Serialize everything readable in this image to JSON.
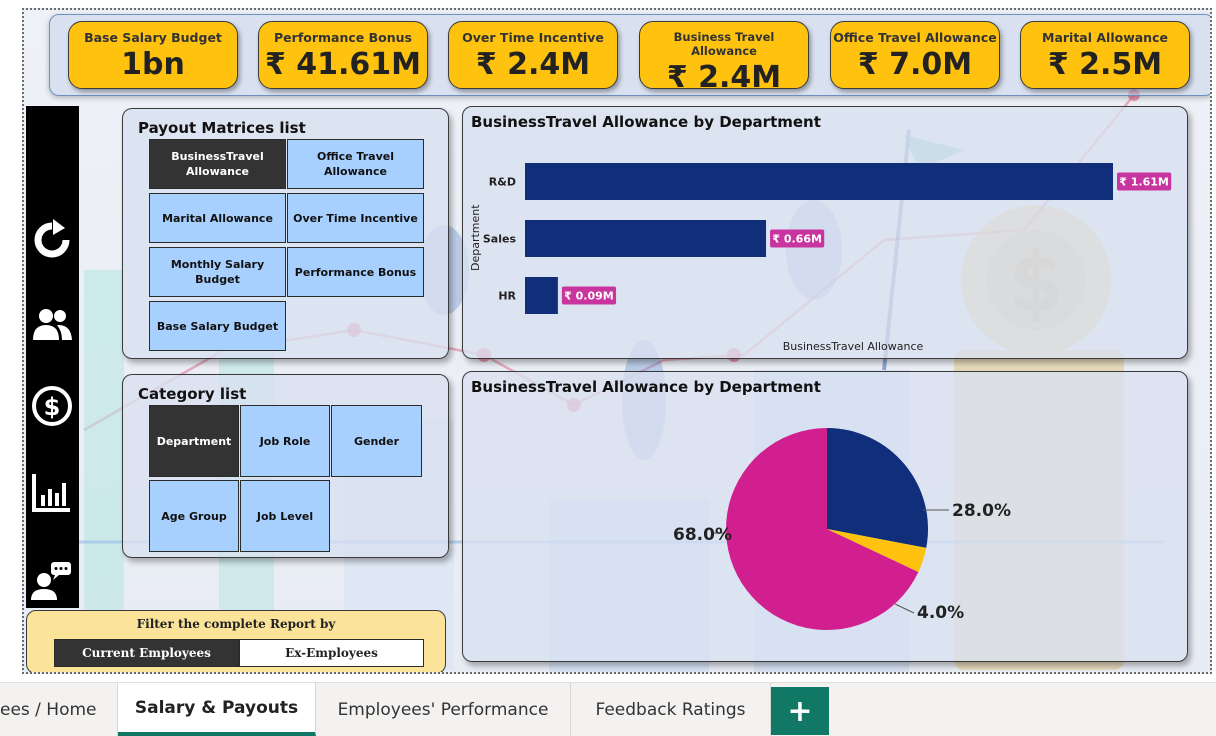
{
  "kpis": [
    {
      "title": "Base Salary Budget",
      "value": "1bn"
    },
    {
      "title": "Performance Bonus",
      "value": "₹ 41.61M"
    },
    {
      "title": "Over Time Incentive",
      "value": "₹ 2.4M"
    },
    {
      "title": "Business Travel Allowance",
      "value": "₹ 2.4M"
    },
    {
      "title": "Office Travel Allowance",
      "value": "₹ 7.0M"
    },
    {
      "title": "Marital Allowance",
      "value": "₹ 2.5M"
    }
  ],
  "nav_rail": {
    "icons": [
      "refresh-icon",
      "users-icon",
      "dollar-icon",
      "bar-chart-icon",
      "feedback-icon"
    ]
  },
  "payout_matrices": {
    "title": "Payout Matrices list",
    "items": [
      {
        "label": "BusinessTravel Allowance",
        "selected": true
      },
      {
        "label": "Office Travel Allowance",
        "selected": false
      },
      {
        "label": "Marital Allowance",
        "selected": false
      },
      {
        "label": "Over Time Incentive",
        "selected": false
      },
      {
        "label": "Monthly Salary Budget",
        "selected": false
      },
      {
        "label": "Performance Bonus",
        "selected": false
      },
      {
        "label": "Base Salary Budget",
        "selected": false
      }
    ]
  },
  "category_list": {
    "title": "Category list",
    "items": [
      {
        "label": "Department",
        "selected": true
      },
      {
        "label": "Job Role",
        "selected": false
      },
      {
        "label": "Gender",
        "selected": false
      },
      {
        "label": "Age Group",
        "selected": false
      },
      {
        "label": "Job Level",
        "selected": false
      }
    ]
  },
  "filter": {
    "title": "Filter the complete Report by",
    "options": [
      {
        "label": "Current Employees",
        "selected": true
      },
      {
        "label": "Ex-Employees",
        "selected": false
      }
    ]
  },
  "chart_data": [
    {
      "type": "bar",
      "orientation": "horizontal",
      "title": "BusinessTravel Allowance by Department",
      "xlabel": "BusinessTravel Allowance",
      "ylabel": "Department",
      "categories": [
        "R&D",
        "Sales",
        "HR"
      ],
      "values": [
        1.61,
        0.66,
        0.09
      ],
      "value_unit": "₹ M",
      "data_labels": [
        "₹ 1.61M",
        "₹ 0.66M",
        "₹ 0.09M"
      ],
      "color": "#102e7a",
      "label_color": "#c8359e",
      "grid": false
    },
    {
      "type": "pie",
      "title": "BusinessTravel Allowance by Department",
      "slices": [
        {
          "value": 68.0,
          "label": "68.0%",
          "color": "#d11f90"
        },
        {
          "value": 28.0,
          "label": "28.0%",
          "color": "#102e7a"
        },
        {
          "value": 4.0,
          "label": "4.0%",
          "color": "#ffc20e"
        }
      ]
    }
  ],
  "tabs": [
    {
      "label": "ees / Home",
      "active": false
    },
    {
      "label": "Salary & Payouts",
      "active": true
    },
    {
      "label": "Employees' Performance",
      "active": false
    },
    {
      "label": "Feedback Ratings",
      "active": false
    }
  ],
  "add_tab_label": "+"
}
